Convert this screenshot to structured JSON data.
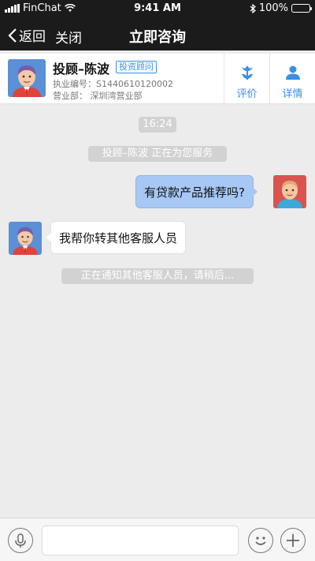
{
  "status_bar": {
    "carrier": "FinChat",
    "time": "9:41 AM",
    "battery": "100%"
  },
  "nav": {
    "back_label": "返回",
    "close_label": "关闭",
    "title": "立即咨询"
  },
  "advisor": {
    "name": "投顾–陈波",
    "tag": "投资顾问",
    "license": "执业编号：S1440610120002",
    "branch": "营业部：  深圳湾营业部",
    "actions": [
      {
        "label": "评价",
        "icon": "tulip-icon"
      },
      {
        "label": "详情",
        "icon": "person-icon"
      }
    ]
  },
  "chat": {
    "time_stamp": "16:24",
    "system_serving": "投顾–陈波  正在为您服务",
    "messages": [
      {
        "from": "user",
        "text": "有贷款产品推荐吗?"
      },
      {
        "from": "advisor",
        "text": "我帮你转其他客服人员"
      }
    ],
    "system_notice": "正在通知其他客服人员，请稍后..."
  },
  "input_bar": {
    "placeholder": "",
    "value": ""
  },
  "colors": {
    "top_bar": "#1b1b1b",
    "accent": "#3a8ee6",
    "user_bubble": "#a7c8f5",
    "background": "#ececec"
  }
}
